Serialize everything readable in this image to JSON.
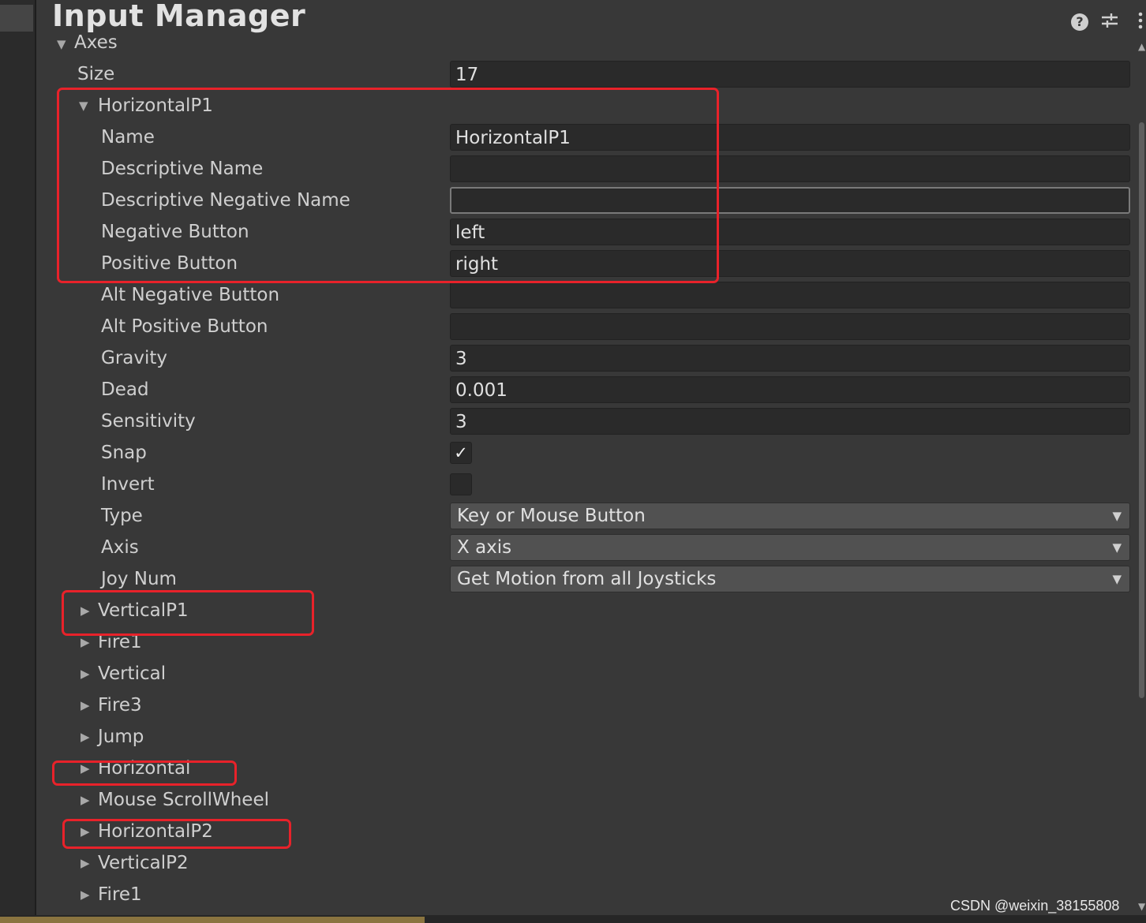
{
  "header": {
    "title": "Input Manager",
    "help_icon": "help-icon",
    "settings_icon": "settings-sliders-icon",
    "menu_icon": "kebab-menu-icon"
  },
  "axes": {
    "label": "Axes",
    "size_label": "Size",
    "size_value": "17"
  },
  "expanded_axis": {
    "title": "HorizontalP1",
    "fields": [
      {
        "label": "Name",
        "value": "HorizontalP1"
      },
      {
        "label": "Descriptive Name",
        "value": ""
      },
      {
        "label": "Descriptive Negative Name",
        "value": ""
      },
      {
        "label": "Negative Button",
        "value": "left"
      },
      {
        "label": "Positive Button",
        "value": "right"
      },
      {
        "label": "Alt Negative Button",
        "value": ""
      },
      {
        "label": "Alt Positive Button",
        "value": ""
      },
      {
        "label": "Gravity",
        "value": "3"
      },
      {
        "label": "Dead",
        "value": "0.001"
      },
      {
        "label": "Sensitivity",
        "value": "3"
      }
    ],
    "snap": {
      "label": "Snap",
      "checked": true,
      "mark": "✓"
    },
    "invert": {
      "label": "Invert",
      "checked": false
    },
    "type": {
      "label": "Type",
      "value": "Key or Mouse Button"
    },
    "axis": {
      "label": "Axis",
      "value": "X axis"
    },
    "joy_num": {
      "label": "Joy Num",
      "value": "Get Motion from all Joysticks"
    }
  },
  "collapsed_axes": [
    "VerticalP1",
    "Fire1",
    "Vertical",
    "Fire3",
    "Jump",
    "Horizontal",
    "Mouse ScrollWheel",
    "HorizontalP2",
    "VerticalP2",
    "Fire1"
  ],
  "highlight_color": "#e8222a",
  "watermark": "CSDN @weixin_38155808"
}
